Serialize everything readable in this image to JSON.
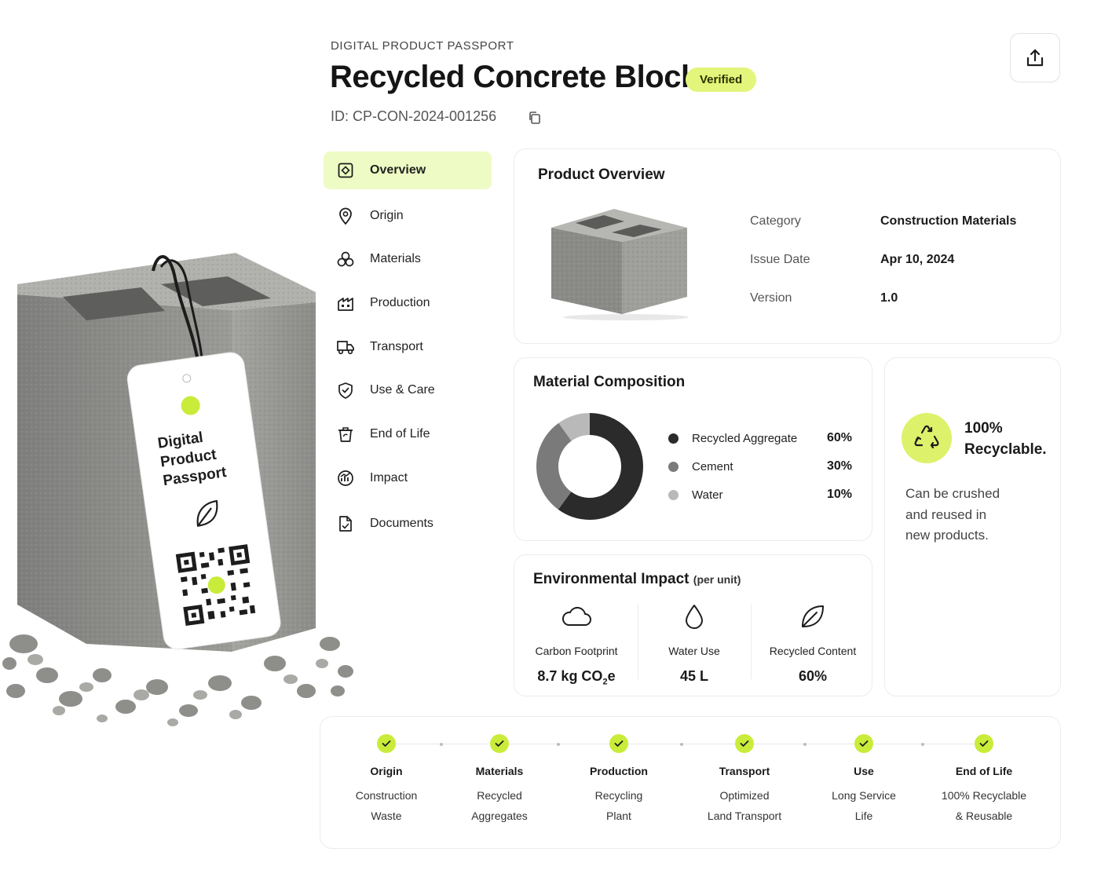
{
  "header": {
    "eyebrow": "DIGITAL PRODUCT PASSPORT",
    "title": "Recycled Concrete Block",
    "badge": "Verified",
    "product_id": "ID: CP-CON-2024-001256"
  },
  "tag": {
    "line1": "Digital",
    "line2": "Product",
    "line3": "Passport"
  },
  "nav": [
    {
      "label": "Overview",
      "icon": "overview-icon",
      "active": true
    },
    {
      "label": "Origin",
      "icon": "location-pin-icon"
    },
    {
      "label": "Materials",
      "icon": "materials-icon"
    },
    {
      "label": "Production",
      "icon": "factory-icon"
    },
    {
      "label": "Transport",
      "icon": "truck-icon"
    },
    {
      "label": "Use & Care",
      "icon": "shield-check-icon"
    },
    {
      "label": "End of Life",
      "icon": "recycle-bin-icon"
    },
    {
      "label": "Impact",
      "icon": "impact-chart-icon"
    },
    {
      "label": "Documents",
      "icon": "document-icon"
    }
  ],
  "overview": {
    "title": "Product Overview",
    "rows": [
      {
        "key": "Category",
        "value": "Construction Materials"
      },
      {
        "key": "Issue Date",
        "value": "Apr 10, 2024"
      },
      {
        "key": "Version",
        "value": "1.0"
      }
    ]
  },
  "composition": {
    "title": "Material Composition",
    "items": [
      {
        "name": "Recycled Aggregate",
        "value": "60%",
        "color": "#2b2b2b"
      },
      {
        "name": "Cement",
        "value": "30%",
        "color": "#7a7a7a"
      },
      {
        "name": "Water",
        "value": "10%",
        "color": "#b9b9b9"
      }
    ]
  },
  "chart_data": {
    "type": "pie",
    "categories": [
      "Recycled Aggregate",
      "Cement",
      "Water"
    ],
    "values": [
      60,
      30,
      10
    ],
    "colors": [
      "#2b2b2b",
      "#7a7a7a",
      "#b9b9b9"
    ],
    "title": ""
  },
  "recycle": {
    "headline1": "100%",
    "headline2": "Recyclable.",
    "desc1": "Can be crushed",
    "desc2": "and reused in",
    "desc3": "new products."
  },
  "impact": {
    "title": "Environmental Impact",
    "subtitle": "(per unit)",
    "metrics": [
      {
        "label": "Carbon Footprint",
        "value_main": "8.7 kg CO",
        "value_sub": "2",
        "value_tail": "e",
        "icon": "cloud-icon"
      },
      {
        "label": "Water Use",
        "value": "45 L",
        "icon": "water-drop-icon"
      },
      {
        "label": "Recycled Content",
        "value": "60%",
        "icon": "leaf-icon"
      }
    ]
  },
  "timeline": [
    {
      "title": "Origin",
      "line1": "Construction",
      "line2": "Waste"
    },
    {
      "title": "Materials",
      "line1": "Recycled",
      "line2": "Aggregates"
    },
    {
      "title": "Production",
      "line1": "Recycling",
      "line2": "Plant"
    },
    {
      "title": "Transport",
      "line1": "Optimized",
      "line2": "Land Transport"
    },
    {
      "title": "Use",
      "line1": "Long Service",
      "line2": "Life"
    },
    {
      "title": "End of Life",
      "line1": "100% Recyclable",
      "line2": "& Reusable"
    }
  ],
  "colors": {
    "accent": "#c9ec3a",
    "badge_bg": "#e3f57a",
    "nav_active_bg": "#eefbc4",
    "text": "#1a1a1a"
  }
}
